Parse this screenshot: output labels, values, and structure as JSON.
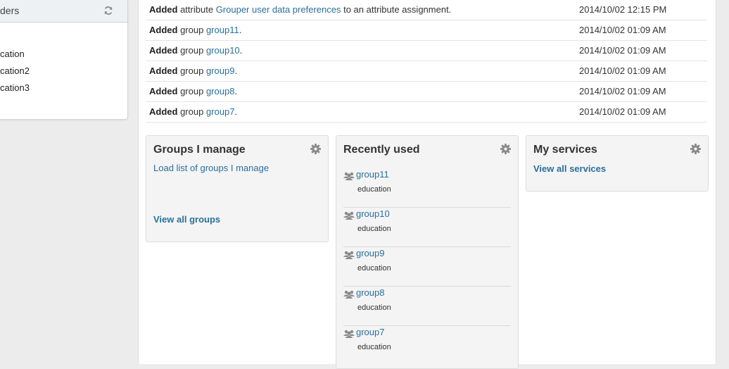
{
  "sidebar": {
    "title": "ders",
    "items": [
      "cation",
      "cation2",
      "cation3"
    ]
  },
  "activity": [
    {
      "action": "Added",
      "pre": "attribute",
      "link": "Grouper user data preferences",
      "post": "to an attribute assignment.",
      "time": "2014/10/02 12:15 PM"
    },
    {
      "action": "Added",
      "pre": "group",
      "link": "group11",
      "post": ".",
      "time": "2014/10/02 01:09 AM"
    },
    {
      "action": "Added",
      "pre": "group",
      "link": "group10",
      "post": ".",
      "time": "2014/10/02 01:09 AM"
    },
    {
      "action": "Added",
      "pre": "group",
      "link": "group9",
      "post": ".",
      "time": "2014/10/02 01:09 AM"
    },
    {
      "action": "Added",
      "pre": "group",
      "link": "group8",
      "post": ".",
      "time": "2014/10/02 01:09 AM"
    },
    {
      "action": "Added",
      "pre": "group",
      "link": "group7",
      "post": ".",
      "time": "2014/10/02 01:09 AM"
    }
  ],
  "groups_i_manage": {
    "title": "Groups I manage",
    "load_link": "Load list of groups I manage",
    "view_all": "View all groups"
  },
  "recently_used": {
    "title": "Recently used",
    "items": [
      {
        "name": "group11",
        "folder": "education"
      },
      {
        "name": "group10",
        "folder": "education"
      },
      {
        "name": "group9",
        "folder": "education"
      },
      {
        "name": "group8",
        "folder": "education"
      },
      {
        "name": "group7",
        "folder": "education"
      }
    ]
  },
  "my_services": {
    "title": "My services",
    "view_all": "View all services"
  },
  "colors": {
    "link": "#2a6f9b",
    "panel_bg": "#f4f4f4",
    "page_bg": "#ececec",
    "icon_gray": "#8a8a8a"
  }
}
